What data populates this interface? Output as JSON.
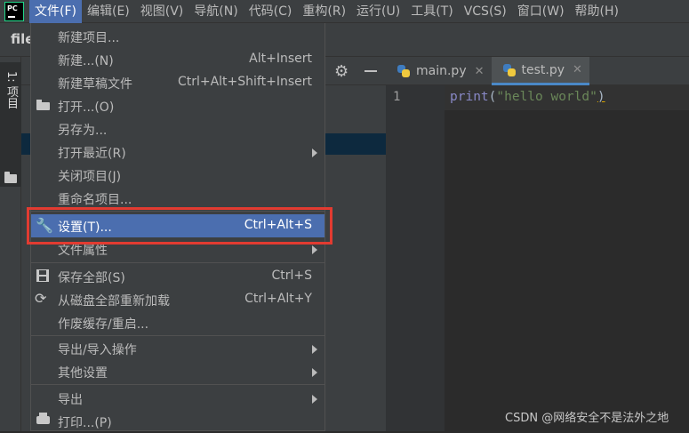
{
  "menubar": {
    "logo_text": "PC",
    "items": [
      "文件(F)",
      "编辑(E)",
      "视图(V)",
      "导航(N)",
      "代码(C)",
      "重构(R)",
      "运行(U)",
      "工具(T)",
      "VCS(S)",
      "窗口(W)",
      "帮助(H)"
    ]
  },
  "navbar": {
    "crumb": "file"
  },
  "toolstrip": {
    "project_tab": "1: 项目"
  },
  "editor": {
    "tabs": [
      {
        "label": "main.py"
      },
      {
        "label": "test.py"
      }
    ],
    "line_number": "1",
    "code": {
      "fn": "print",
      "open": "(",
      "str": "\"hello world\"",
      "close": ")"
    }
  },
  "file_menu": {
    "items": [
      {
        "label": "新建项目...",
        "shortcut": ""
      },
      {
        "label": "新建...(N)",
        "shortcut": "Alt+Insert"
      },
      {
        "label": "新建草稿文件",
        "shortcut": "Ctrl+Alt+Shift+Insert"
      },
      {
        "label": "打开...(O)",
        "shortcut": ""
      },
      {
        "label": "另存为...",
        "shortcut": ""
      },
      {
        "label": "打开最近(R)",
        "shortcut": ""
      },
      {
        "label": "关闭项目(J)",
        "shortcut": ""
      },
      {
        "label": "重命名项目...",
        "shortcut": ""
      },
      {
        "label": "设置(T)...",
        "shortcut": "Ctrl+Alt+S"
      },
      {
        "label": "文件属性",
        "shortcut": ""
      },
      {
        "label": "保存全部(S)",
        "shortcut": "Ctrl+S"
      },
      {
        "label": "从磁盘全部重新加载",
        "shortcut": "Ctrl+Alt+Y"
      },
      {
        "label": "作废缓存/重启...",
        "shortcut": ""
      },
      {
        "label": "导出/导入操作",
        "shortcut": ""
      },
      {
        "label": "其他设置",
        "shortcut": ""
      },
      {
        "label": "导出",
        "shortcut": ""
      },
      {
        "label": "打印...(P)",
        "shortcut": ""
      }
    ]
  },
  "watermark": "CSDN @网络安全不是法外之地",
  "colors": {
    "highlight": "#4b6eaf",
    "annotation_box": "#e23b31"
  }
}
